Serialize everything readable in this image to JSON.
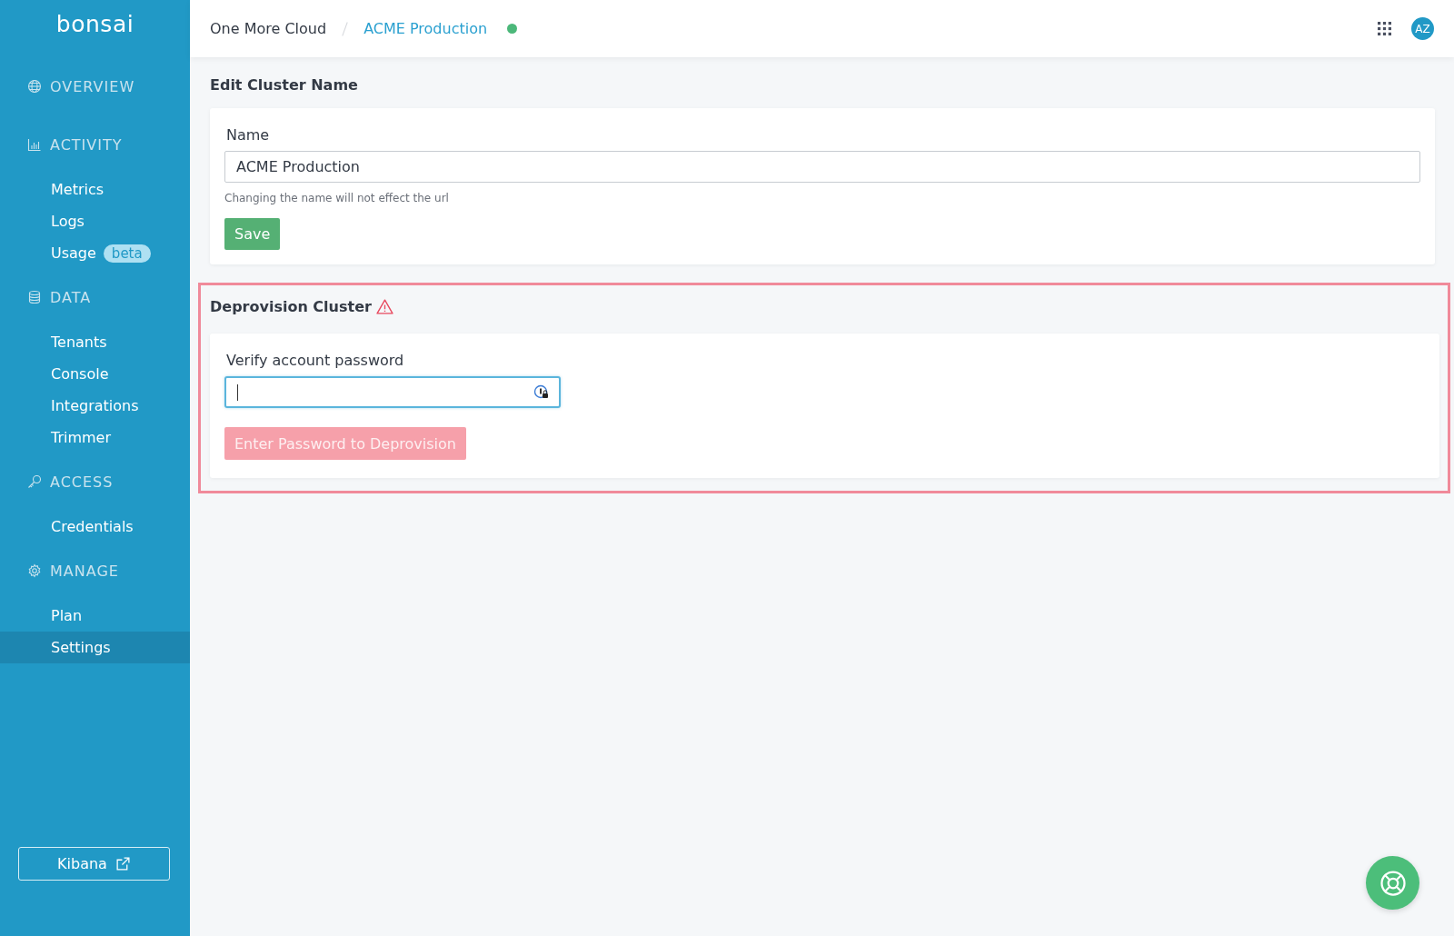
{
  "sidebar": {
    "logo": "bonsai",
    "sections": [
      {
        "title": "OVERVIEW"
      },
      {
        "title": "ACTIVITY",
        "items": [
          {
            "label": "Metrics",
            "selected": false
          },
          {
            "label": "Logs",
            "selected": false
          },
          {
            "label": "Usage",
            "selected": false,
            "badge": "beta"
          }
        ]
      },
      {
        "title": "DATA",
        "items": [
          {
            "label": "Tenants",
            "selected": false
          },
          {
            "label": "Console",
            "selected": false
          },
          {
            "label": "Integrations",
            "selected": false
          },
          {
            "label": "Trimmer",
            "selected": false
          }
        ]
      },
      {
        "title": "ACCESS",
        "items": [
          {
            "label": "Credentials",
            "selected": false
          }
        ]
      },
      {
        "title": "MANAGE",
        "items": [
          {
            "label": "Plan",
            "selected": false
          },
          {
            "label": "Settings",
            "selected": true
          }
        ]
      }
    ],
    "footer_button": "Kibana"
  },
  "breadcrumb": [
    "One More Cloud",
    "ACME Production"
  ],
  "user": {
    "initials": "AZ"
  },
  "edit_section": {
    "title": "Edit Cluster Name",
    "label": "Name",
    "value": "ACME Production",
    "help": "Changing the name will not effect the url",
    "button": "Save"
  },
  "deprovision_section": {
    "title": "Deprovision Cluster",
    "label": "Verify account password",
    "focused": true,
    "button": "Enter Password to Deprovision",
    "button_disabled": true
  }
}
